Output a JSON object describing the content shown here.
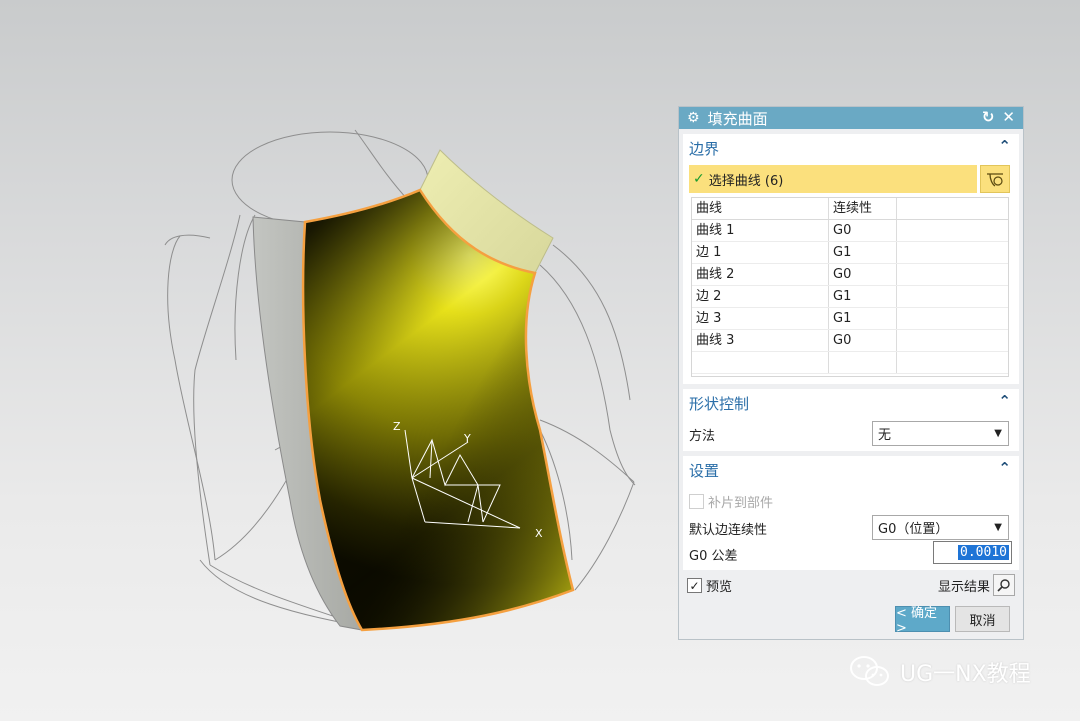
{
  "dialog": {
    "title": "填充曲面",
    "boundary": {
      "header": "边界",
      "select_label": "选择曲线 (6)",
      "table": {
        "columns": [
          "曲线",
          "连续性"
        ],
        "rows": [
          {
            "name": "曲线 1",
            "cont": "G0"
          },
          {
            "name": "边 1",
            "cont": "G1"
          },
          {
            "name": "曲线 2",
            "cont": "G0"
          },
          {
            "name": "边 2",
            "cont": "G1"
          },
          {
            "name": "边 3",
            "cont": "G1"
          },
          {
            "name": "曲线 3",
            "cont": "G0"
          }
        ]
      }
    },
    "shape": {
      "header": "形状控制",
      "method_label": "方法",
      "method_value": "无"
    },
    "settings": {
      "header": "设置",
      "patch_label": "补片到部件",
      "default_cont_label": "默认边连续性",
      "default_cont_value": "G0（位置）",
      "tol_label": "G0 公差",
      "tol_value": "0.0010"
    },
    "preview_label": "预览",
    "show_result_label": "显示结果",
    "ok_label": "< 确定 >",
    "cancel_label": "取消"
  },
  "viewport": {
    "axes": {
      "x": "X",
      "y": "Y",
      "z": "Z"
    }
  },
  "watermark": "UG一NX教程",
  "colors": {
    "title_bar": "#6aa9c4",
    "selection": "#fbe07d",
    "surface_yellow": "#e8e21a",
    "surface_edge": "#f5a040"
  },
  "icons": [
    "gear-icon",
    "reset-icon",
    "close-icon",
    "collapse-icon",
    "curve-select-icon",
    "magnifier-icon",
    "dropdown-arrow-icon",
    "wechat-icon"
  ]
}
